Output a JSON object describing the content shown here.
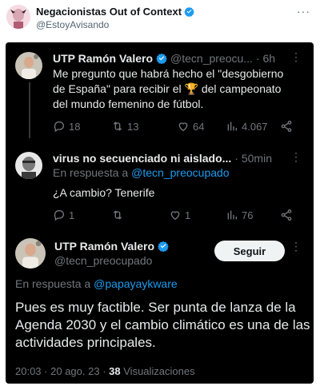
{
  "outer": {
    "name": "Negacionistas Out of Context",
    "handle": "@EstoyAvisando",
    "more": "···"
  },
  "tweet1": {
    "name": "UTP Ramón Valero",
    "handle": "@tecn_preocu...",
    "time": "· 6h",
    "text_before": "Me pregunto que habrá hecho el \"desgobierno de España\" para recibir el ",
    "trophy": "🏆",
    "text_after": " del campeonato del mundo femenino de fútbol.",
    "replies": "18",
    "retweets": "13",
    "likes": "64",
    "views": "4.067"
  },
  "tweet2": {
    "name": "virus no secuenciado ni aislado...",
    "time": "· 50min",
    "reply_prefix": "En respuesta a",
    "reply_to": "@tecn_preocupado",
    "text": "¿A cambio? Tenerife",
    "replies": "1",
    "retweets": "",
    "likes": "1",
    "views": "76"
  },
  "tweet3": {
    "name": "UTP Ramón Valero",
    "handle": "@tecn_preocupado",
    "follow_label": "Seguir",
    "reply_prefix": "En respuesta a",
    "reply_to": "@papayaykware",
    "text": "Pues es muy factible. Ser punta de lanza de la Agenda 2030 y el cambio climático es una de las actividades principales.",
    "time": "20:03",
    "date": "20 ago. 23",
    "views_count": "38",
    "views_label": "Visualizaciones"
  },
  "colors": {
    "verified": "#1d9bf0",
    "background": "#000000",
    "text": "#e7e9ea",
    "secondary": "#71767b",
    "link": "#1d9bf0"
  }
}
